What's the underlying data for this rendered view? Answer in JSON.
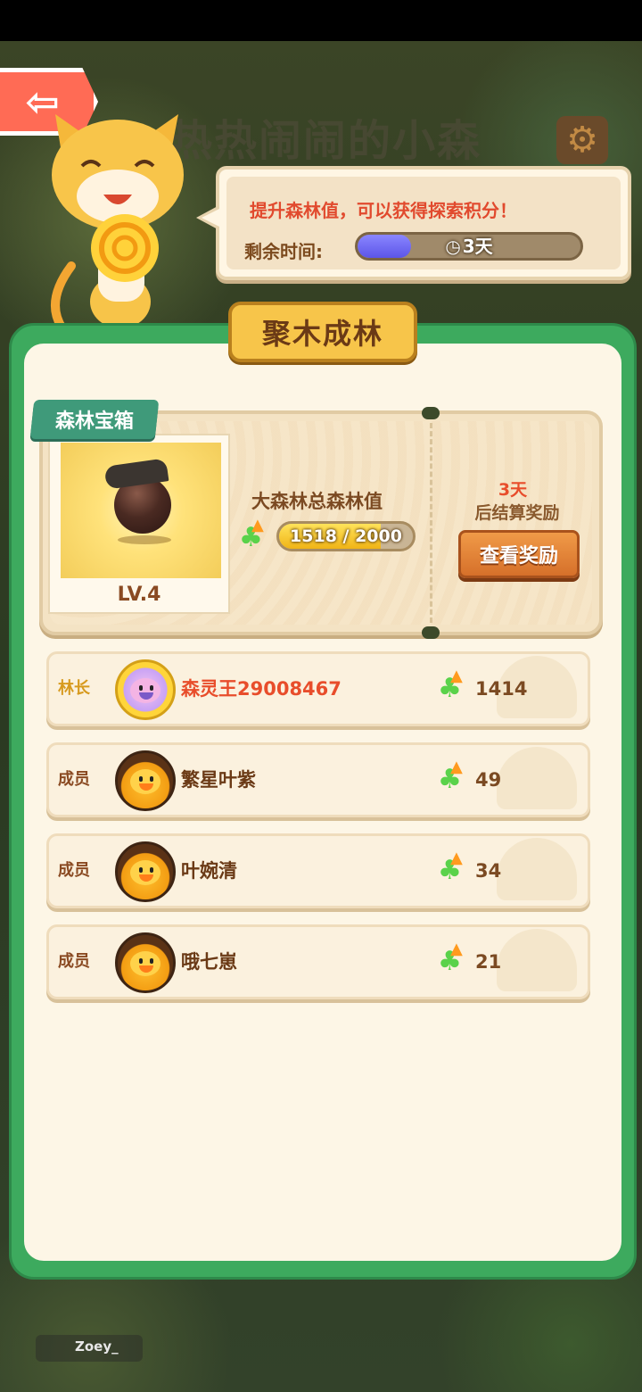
{
  "background": {
    "title": "热热闹闹的小森",
    "username": "Zoey_"
  },
  "header": {
    "back_icon": "arrow-left-icon",
    "settings_icon": "gear-icon"
  },
  "bubble": {
    "tip": "提升森林值，可以获得探索积分！",
    "timer_label": "剩余时间:",
    "timer_value": "3天",
    "timer_progress": 0.24
  },
  "panel": {
    "title": "聚木成林"
  },
  "chest": {
    "tag": "森林宝箱",
    "level": "LV.4",
    "total_label": "大森林总森林值",
    "total_text": "1518 / 2000",
    "total_current": 1518,
    "total_max": 2000,
    "days": "3天",
    "settle_label": "后结算奖励",
    "reward_button": "查看奖励"
  },
  "members": [
    {
      "role": "林长",
      "name": "森灵王29008467",
      "score": "1414",
      "is_leader": true
    },
    {
      "role": "成员",
      "name": "繁星叶紫",
      "score": "49",
      "is_leader": false
    },
    {
      "role": "成员",
      "name": "叶婉清",
      "score": "34",
      "is_leader": false
    },
    {
      "role": "成员",
      "name": "哦七崽",
      "score": "21",
      "is_leader": false
    }
  ],
  "colors": {
    "panel_green": "#3daa5e",
    "accent_red": "#e84d2b",
    "title_gold": "#f7c54a",
    "timer_purple": "#5c55e8"
  }
}
